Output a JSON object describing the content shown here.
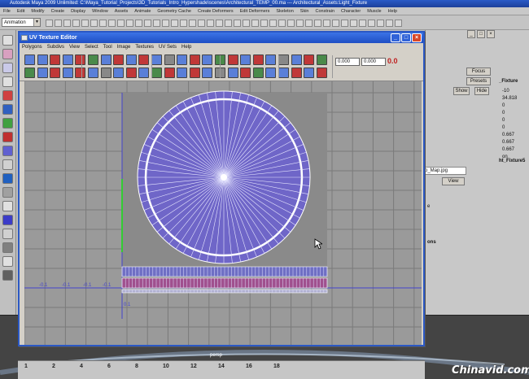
{
  "app": {
    "title": "Autodesk Maya 2009 Unlimited: C:\\Maya_Tutorial_Projects\\3D_Tutorials_Intro_Hypershade\\scenes\\Architectural_TEMP_00.ma    ---   Architectural_Assets:Light_Fixture",
    "menus": [
      "File",
      "Edit",
      "Modify",
      "Create",
      "Display",
      "Window",
      "Assets",
      "Animate",
      "Geometry Cache",
      "Create Deformers",
      "Edit Deformers",
      "Skeleton",
      "Skin",
      "Constrain",
      "Character",
      "Muscle",
      "Help"
    ],
    "mode": "Animation"
  },
  "uv_editor": {
    "title": "UV Texture Editor",
    "menus": [
      "Polygons",
      "Subdivs",
      "View",
      "Select",
      "Tool",
      "Image",
      "Textures",
      "UV Sets",
      "Help"
    ],
    "field_u": "0.000",
    "field_v": "0.000",
    "label_00": "0.0",
    "grid_labels": [
      "-0.1",
      "-0.1",
      "-0.1",
      "-0.1"
    ],
    "bottom_label": "0.1"
  },
  "right_panel": {
    "focus": "Focus",
    "presets": "Presets",
    "show": "Show",
    "hide": "Hide",
    "node_name": "_Fixture",
    "channels": [
      "-10",
      "34.818",
      "0",
      "0",
      "0",
      "0",
      "0.667",
      "0.667",
      "0.667",
      "on"
    ],
    "file_map": "p_Map.jpg",
    "view": "View",
    "node_name_2": "ht_Fixture5",
    "ons": "ons",
    "section_e": "e"
  },
  "viewport": {
    "label": "persp"
  },
  "timeslider": {
    "ticks": [
      "1",
      "2",
      "4",
      "6",
      "8",
      "10",
      "12",
      "14",
      "16",
      "18"
    ]
  },
  "watermark": "Chinavid.com",
  "colors": {
    "title_blue": "#2b58c4",
    "uv_shell": "#6f66c8",
    "uv_strip_blue": "#6f6fc4",
    "uv_strip_pink": "#a0508e"
  }
}
